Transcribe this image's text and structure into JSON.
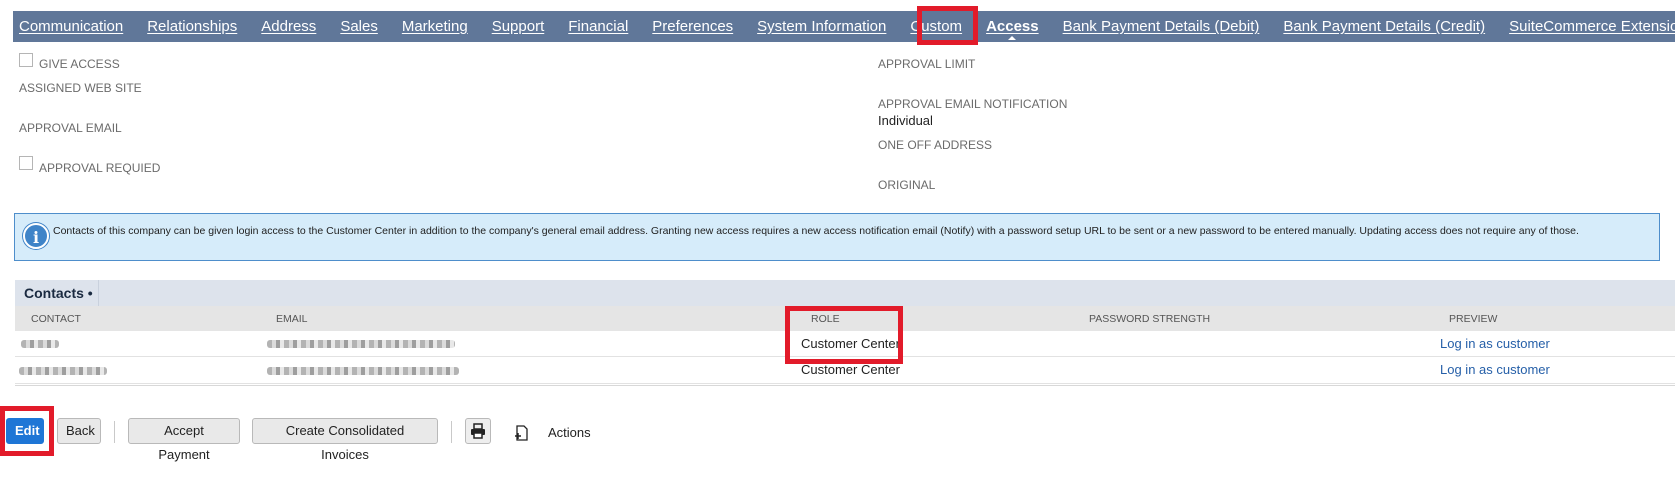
{
  "tabs": [
    "Communication",
    "Relationships",
    "Address",
    "Sales",
    "Marketing",
    "Support",
    "Financial",
    "Preferences",
    "System Information",
    "Custom",
    "Access",
    "Bank Payment Details (Debit)",
    "Bank Payment Details (Credit)",
    "SuiteCommerce Extensions"
  ],
  "active_tab": "Access",
  "fields": {
    "give_access": "GIVE ACCESS",
    "assigned_web_site": "ASSIGNED WEB SITE",
    "approval_email": "APPROVAL EMAIL",
    "approval_required": "APPROVAL REQUIED",
    "approval_limit": "APPROVAL LIMIT",
    "approval_email_notification": "APPROVAL EMAIL NOTIFICATION",
    "approval_email_notification_value": "Individual",
    "one_off_address": "ONE OFF ADDRESS",
    "original": "ORIGINAL"
  },
  "info_text": "Contacts of this company can be given login access to the Customer Center in addition to the company's general email address. Granting new access requires a new access notification email (Notify) with a password setup URL to be sent or a new password to be entered manually. Updating access does not require any of those.",
  "contacts": {
    "tab_label": "Contacts •",
    "columns": [
      "CONTACT",
      "EMAIL",
      "ROLE",
      "PASSWORD STRENGTH",
      "PREVIEW"
    ],
    "rows": [
      {
        "role": "Customer Center",
        "preview": "Log in as customer"
      },
      {
        "role": "Customer Center",
        "preview": "Log in as customer"
      }
    ]
  },
  "buttons": {
    "edit": "Edit",
    "back": "Back",
    "accept_payment": "Accept Payment",
    "create_consolidated_invoices": "Create Consolidated Invoices",
    "actions": "Actions"
  },
  "colors": {
    "tabbar": "#607799",
    "highlight": "#e21b2a",
    "primary_button": "#1e76d6",
    "link": "#255fa8"
  }
}
